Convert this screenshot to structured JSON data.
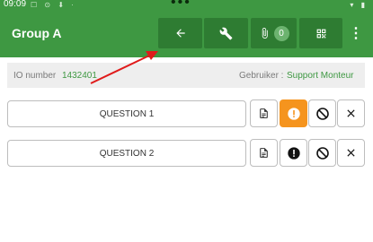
{
  "status_bar": {
    "time": "09:09",
    "left_icons": "☐ ⊙ ⬇ ·",
    "right_icons": "▾ ▮"
  },
  "header": {
    "title": "Group A",
    "attachment_count": "0"
  },
  "info": {
    "io_label": "IO number",
    "io_value": "1432401",
    "user_label": "Gebruiker :",
    "user_value": "Support Monteur"
  },
  "questions": [
    {
      "label": "QUESTION 1",
      "info_active": true
    },
    {
      "label": "QUESTION 2",
      "info_active": false
    }
  ],
  "colors": {
    "appbar": "#3e9842",
    "toolbar_button": "#2e7c32",
    "accent_green": "#3e9842",
    "info_active": "#f5941e",
    "annotation_arrow": "#e01b1b"
  },
  "icons": [
    "back-arrow-icon",
    "wrench-icon",
    "paperclip-icon",
    "qr-code-icon",
    "more-vert-icon",
    "document-icon",
    "info-icon",
    "block-icon",
    "close-icon"
  ]
}
